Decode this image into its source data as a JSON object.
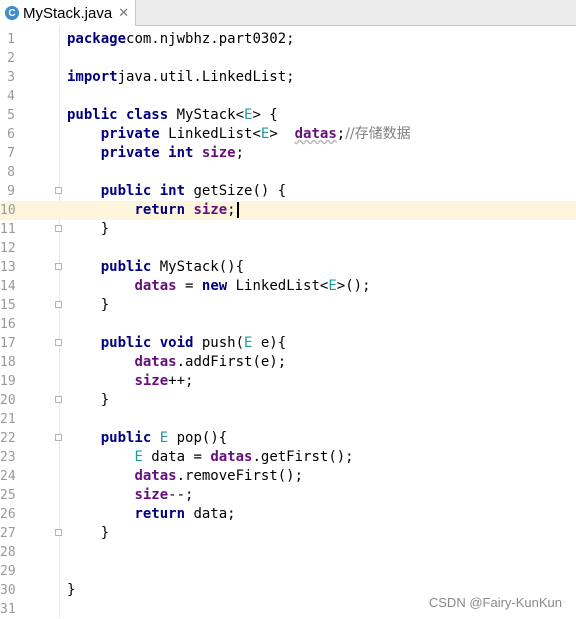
{
  "tab": {
    "title": "MyStack.java",
    "icon": "java-class-icon",
    "icon_letter": "C",
    "close": "✕"
  },
  "watermark": "CSDN @Fairy-KunKun",
  "colors": {
    "keyword": "#000080",
    "field": "#660e7a",
    "type_param": "#20999d",
    "comment": "#808080",
    "current_line": "#fdf6dd"
  },
  "current_line": 10,
  "lines": [
    {
      "n": "1",
      "t": [
        [
          "kw",
          "package"
        ],
        [
          "",
          "com.njwbhz.part0302;"
        ]
      ]
    },
    {
      "n": "2",
      "t": []
    },
    {
      "n": "3",
      "t": [
        [
          "kw",
          "import"
        ],
        [
          "",
          "java.util.LinkedList;"
        ]
      ]
    },
    {
      "n": "4",
      "t": []
    },
    {
      "n": "5",
      "t": [
        [
          "kw",
          "public class"
        ],
        [
          "",
          " MyStack<"
        ],
        [
          "tp",
          "E"
        ],
        [
          "",
          "> {"
        ]
      ]
    },
    {
      "n": "6",
      "t": [
        [
          "",
          "    "
        ],
        [
          "kw",
          "private"
        ],
        [
          "",
          " LinkedList<"
        ],
        [
          "tp",
          "E"
        ],
        [
          "",
          ">  "
        ],
        [
          "fw",
          "datas"
        ],
        [
          "",
          ";"
        ],
        [
          "cm",
          "//存储数据"
        ]
      ]
    },
    {
      "n": "7",
      "t": [
        [
          "",
          "    "
        ],
        [
          "kw",
          "private int"
        ],
        [
          "",
          " "
        ],
        [
          "fld",
          "size"
        ],
        [
          "",
          ";"
        ]
      ]
    },
    {
      "n": "8",
      "t": []
    },
    {
      "n": "9",
      "t": [
        [
          "",
          "    "
        ],
        [
          "kw",
          "public int"
        ],
        [
          "",
          " getSize() {"
        ]
      ],
      "fold": true
    },
    {
      "n": "10",
      "t": [
        [
          "",
          "        "
        ],
        [
          "kw",
          "return"
        ],
        [
          "",
          " "
        ],
        [
          "fld",
          "size"
        ],
        [
          "",
          ";"
        ]
      ],
      "caret": true
    },
    {
      "n": "11",
      "t": [
        [
          "",
          "    }"
        ]
      ],
      "fold": true
    },
    {
      "n": "12",
      "t": []
    },
    {
      "n": "13",
      "t": [
        [
          "",
          "    "
        ],
        [
          "kw",
          "public"
        ],
        [
          "",
          " MyStack(){"
        ]
      ],
      "fold": true
    },
    {
      "n": "14",
      "t": [
        [
          "",
          "        "
        ],
        [
          "fld",
          "datas"
        ],
        [
          "",
          " = "
        ],
        [
          "kw",
          "new"
        ],
        [
          "",
          " LinkedList<"
        ],
        [
          "tp",
          "E"
        ],
        [
          "",
          ">();"
        ]
      ]
    },
    {
      "n": "15",
      "t": [
        [
          "",
          "    }"
        ]
      ],
      "fold": true
    },
    {
      "n": "16",
      "t": []
    },
    {
      "n": "17",
      "t": [
        [
          "",
          "    "
        ],
        [
          "kw",
          "public void"
        ],
        [
          "",
          " push("
        ],
        [
          "tp",
          "E"
        ],
        [
          "",
          " e){"
        ]
      ],
      "fold": true
    },
    {
      "n": "18",
      "t": [
        [
          "",
          "        "
        ],
        [
          "fld",
          "datas"
        ],
        [
          "",
          ".addFirst(e);"
        ]
      ]
    },
    {
      "n": "19",
      "t": [
        [
          "",
          "        "
        ],
        [
          "fld",
          "size"
        ],
        [
          "",
          "++;"
        ]
      ]
    },
    {
      "n": "20",
      "t": [
        [
          "",
          "    }"
        ]
      ],
      "fold": true
    },
    {
      "n": "21",
      "t": []
    },
    {
      "n": "22",
      "t": [
        [
          "",
          "    "
        ],
        [
          "kw",
          "public"
        ],
        [
          "",
          " "
        ],
        [
          "tp",
          "E"
        ],
        [
          "",
          " pop(){"
        ]
      ],
      "fold": true
    },
    {
      "n": "23",
      "t": [
        [
          "",
          "        "
        ],
        [
          "tp",
          "E"
        ],
        [
          "",
          " data = "
        ],
        [
          "fld",
          "datas"
        ],
        [
          "",
          ".getFirst();"
        ]
      ]
    },
    {
      "n": "24",
      "t": [
        [
          "",
          "        "
        ],
        [
          "fld",
          "datas"
        ],
        [
          "",
          ".removeFirst();"
        ]
      ]
    },
    {
      "n": "25",
      "t": [
        [
          "",
          "        "
        ],
        [
          "fld",
          "size"
        ],
        [
          "",
          "--;"
        ]
      ]
    },
    {
      "n": "26",
      "t": [
        [
          "",
          "        "
        ],
        [
          "kw",
          "return"
        ],
        [
          "",
          " data;"
        ]
      ]
    },
    {
      "n": "27",
      "t": [
        [
          "",
          "    }"
        ]
      ],
      "fold": true
    },
    {
      "n": "28",
      "t": []
    },
    {
      "n": "29",
      "t": []
    },
    {
      "n": "30",
      "t": [
        [
          "",
          "}"
        ]
      ]
    },
    {
      "n": "31",
      "t": []
    }
  ]
}
